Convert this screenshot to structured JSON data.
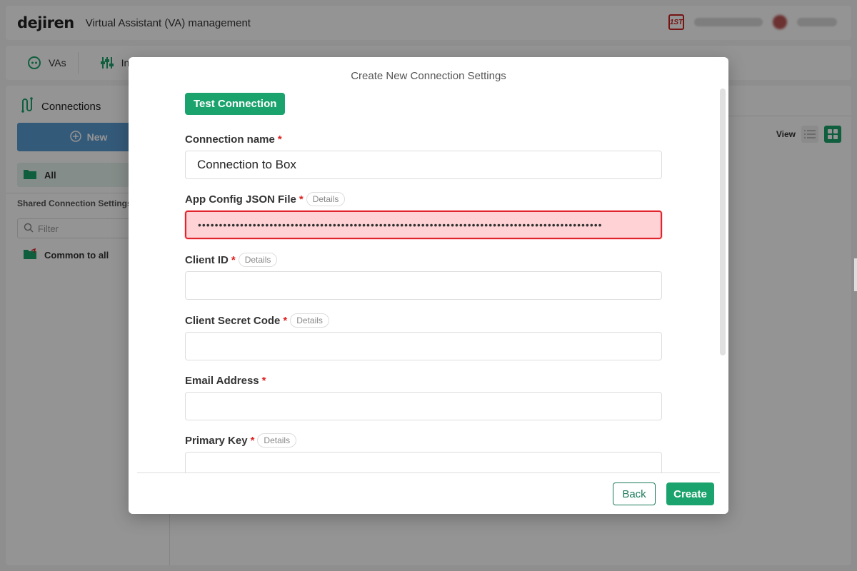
{
  "app": {
    "logo": "dejiren",
    "title": "Virtual Assistant (VA) management",
    "brand_badge": "1ST"
  },
  "nav": {
    "items": [
      {
        "label": "VAs",
        "icon": "robot-icon"
      },
      {
        "label": "In",
        "icon": "sliders-icon"
      }
    ]
  },
  "sidebar": {
    "title": "Connections",
    "new_label": "New",
    "all_label": "All",
    "shared_label": "Shared Connection Settings",
    "filter_placeholder": "Filter",
    "common_label": "Common to all"
  },
  "main": {
    "view_label": "View"
  },
  "modal": {
    "title": "Create New Connection Settings",
    "test_button": "Test Connection",
    "fields": [
      {
        "label": "Connection name",
        "required": "*",
        "value": "Connection to Box",
        "has_details": false
      },
      {
        "label": "App Config JSON File",
        "required": "*",
        "details": "Details",
        "value": "••••••••••••••••••••••••••••••••••••••••••••••••••••••••••••••••••••••••••••••••••••••••••••••••",
        "error": true
      },
      {
        "label": "Client ID",
        "required": "*",
        "details": "Details",
        "value": ""
      },
      {
        "label": "Client Secret Code",
        "required": "*",
        "details": "Details",
        "value": ""
      },
      {
        "label": "Email Address",
        "required": "*",
        "value": ""
      },
      {
        "label": "Primary Key",
        "required": "*",
        "details": "Details",
        "value": ""
      }
    ],
    "back_button": "Back",
    "create_button": "Create"
  },
  "colors": {
    "accent": "#1aa36c",
    "error_border": "#e0242d",
    "error_fill": "#ffd3d5",
    "required": "#dd2222"
  }
}
